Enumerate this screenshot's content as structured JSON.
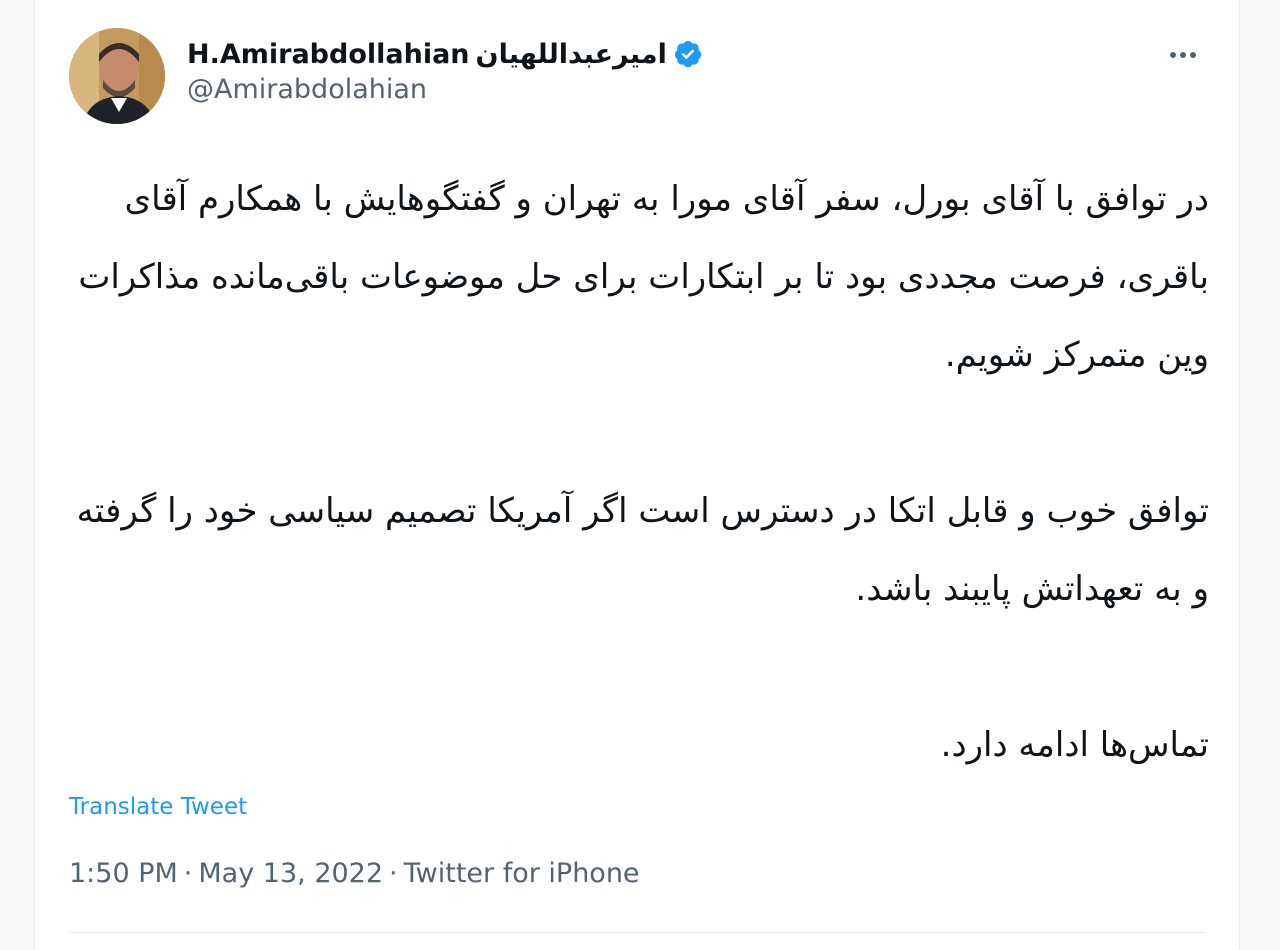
{
  "user": {
    "display_name_latin": "H.Amirabdollahian",
    "display_name_persian": "امیرعبداللهیان",
    "handle": "@Amirabdolahian"
  },
  "tweet": {
    "paragraphs": [
      "در توافق با آقای بورل، سفر آقای مورا به تهران و گفتگوهایش با همکارم آقای باقری، فرصت مجددی بود تا بر ابتکارات برای حل موضوعات باقی‌مانده مذاکرات وین متمرکز شویم.",
      "توافق خوب و قابل اتکا در دسترس است اگر آمریکا تصمیم سیاسی خود را گرفته و به تعهداتش پایبند باشد.",
      "تماس‌ها ادامه دارد."
    ],
    "translate_label": "Translate Tweet",
    "time": "1:50 PM",
    "date": "May 13, 2022",
    "source": "Twitter for iPhone",
    "separator": "·"
  },
  "icons": {
    "verified": "verified-badge-icon",
    "more": "more-options-icon"
  },
  "colors": {
    "link": "#1d9bf0",
    "secondary_text": "#536471",
    "primary_text": "#0f1419"
  }
}
